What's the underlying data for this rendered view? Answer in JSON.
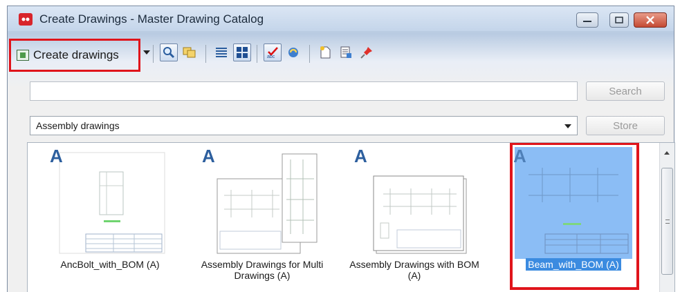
{
  "window": {
    "title": "Create Drawings - Master Drawing Catalog"
  },
  "toolbar": {
    "create_label": "Create drawings",
    "icons": [
      "magnifier-icon",
      "copy-icon",
      "list-view-icon",
      "grid-view-icon",
      "spellcheck-icon",
      "refresh-icon",
      "new-icon",
      "properties-icon",
      "pin-icon"
    ]
  },
  "search": {
    "value": "",
    "button_label": "Search"
  },
  "filter": {
    "selected": "Assembly drawings",
    "store_label": "Store"
  },
  "gallery": {
    "items": [
      {
        "badge": "A",
        "caption": "AncBolt_with_BOM (A)",
        "selected": false
      },
      {
        "badge": "A",
        "caption": "Assembly Drawings for Multi Drawings (A)",
        "selected": false
      },
      {
        "badge": "A",
        "caption": "Assembly Drawings with BOM (A)",
        "selected": false
      },
      {
        "badge": "A",
        "caption": "Beam_with_BOM (A)",
        "selected": true
      }
    ]
  },
  "colors": {
    "highlight_red": "#e0141b",
    "selection_blue": "#8bbdf5",
    "badge_blue": "#2d5f9e"
  }
}
